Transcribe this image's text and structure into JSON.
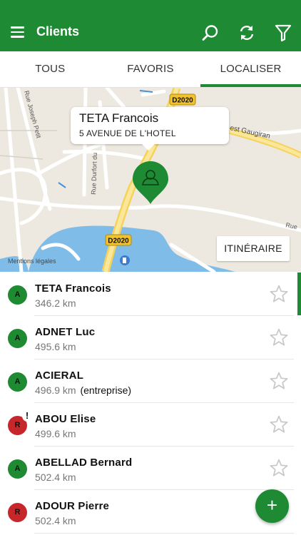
{
  "app_bar": {
    "title": "Clients",
    "icons": [
      "menu-icon",
      "search-icon",
      "refresh-icon",
      "filter-icon"
    ]
  },
  "tabs": [
    {
      "label": "TOUS"
    },
    {
      "label": "FAVORIS"
    },
    {
      "label": "LOCALISER",
      "active": true
    }
  ],
  "map": {
    "popup": {
      "name": "TETA  Francois",
      "address": "5 AVENUE DE L'HOTEL"
    },
    "streets": [
      "Rue Joseph Petit",
      "Rue Durfort du",
      "est Gaugiran",
      "Rue"
    ],
    "road_badges": [
      "D2020",
      "D2020"
    ],
    "itinerary_label": "ITINÉRAIRE",
    "legal_label": "Mentions légales"
  },
  "clients": [
    {
      "badge": "A",
      "status": "green",
      "name": "TETA  Francois",
      "distance": "346.2 km",
      "note": "",
      "alert": false
    },
    {
      "badge": "A",
      "status": "green",
      "name": "ADNET  Luc",
      "distance": "495.6 km",
      "note": "",
      "alert": false
    },
    {
      "badge": "A",
      "status": "green",
      "name": "ACIERAL",
      "distance": "496.9 km",
      "note": "(entreprise)",
      "alert": false
    },
    {
      "badge": "R",
      "status": "red",
      "name": "ABOU  Elise",
      "distance": "499.6 km",
      "note": "",
      "alert": true,
      "alert_mark": "!"
    },
    {
      "badge": "A",
      "status": "green",
      "name": "ABELLAD  Bernard",
      "distance": "502.4 km",
      "note": "",
      "alert": false
    },
    {
      "badge": "R",
      "status": "red",
      "name": "ADOUR  Pierre",
      "distance": "502.4 km",
      "note": "",
      "alert": false
    }
  ],
  "fab_label": "+",
  "colors": {
    "primary": "#1f8a34",
    "badge_green": "#1e8a32",
    "badge_red": "#c7262b"
  }
}
